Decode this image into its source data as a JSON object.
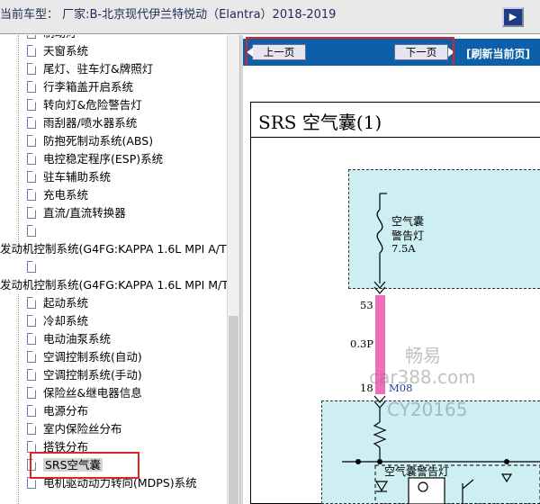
{
  "header": {
    "title": "当前车型： 厂家:B-北京现代伊兰特悦动（Elantra）2018-2019",
    "toggle_icon": "panel-toggle-icon"
  },
  "tree": {
    "items": [
      {
        "label": "制动灯",
        "type": "leaf"
      },
      {
        "label": "天窗系统",
        "type": "leaf"
      },
      {
        "label": "尾灯、驻车灯&牌照灯",
        "type": "leaf"
      },
      {
        "label": "行李箱盖开启系统",
        "type": "leaf"
      },
      {
        "label": "转向灯&危险警告灯",
        "type": "leaf"
      },
      {
        "label": "雨刮器/喷水器系统",
        "type": "leaf"
      },
      {
        "label": "防抱死制动系统(ABS)",
        "type": "leaf"
      },
      {
        "label": "电控稳定程序(ESP)系统",
        "type": "leaf"
      },
      {
        "label": "驻车辅助系统",
        "type": "leaf"
      },
      {
        "label": "充电系统",
        "type": "leaf"
      },
      {
        "label": "直流/直流转换器",
        "type": "leaf"
      },
      {
        "label": "",
        "type": "leaf"
      },
      {
        "label": "发动机控制系统(G4FG:KAPPA 1.6L MPI A/T",
        "type": "folder"
      },
      {
        "label": "",
        "type": "leaf"
      },
      {
        "label": "发动机控制系统(G4FG:KAPPA 1.6L MPI M/T",
        "type": "folder"
      },
      {
        "label": "起动系统",
        "type": "leaf"
      },
      {
        "label": "冷却系统",
        "type": "leaf"
      },
      {
        "label": "电动油泵系统",
        "type": "leaf"
      },
      {
        "label": "空调控制系统(自动)",
        "type": "leaf"
      },
      {
        "label": "空调控制系统(手动)",
        "type": "leaf"
      },
      {
        "label": "保险丝&继电器信息",
        "type": "leaf"
      },
      {
        "label": "电源分布",
        "type": "leaf"
      },
      {
        "label": "室内保险丝分布",
        "type": "leaf"
      },
      {
        "label": "搭铁分布",
        "type": "leaf"
      },
      {
        "label": "SRS空气囊",
        "type": "leaf",
        "selected": true
      },
      {
        "label": "电机驱动动力转向(MDPS)系统",
        "type": "leaf"
      }
    ]
  },
  "nav": {
    "prev_label": "上一页",
    "next_label": "下一页",
    "refresh_label": "[刷新当前页]"
  },
  "diagram": {
    "title": "SRS   空气囊(1)",
    "fuse_name": "空气囊",
    "fuse_name2": "警告灯",
    "fuse_rating": "7.5A",
    "pin_top": "53",
    "wire_spec": "0.3P",
    "pin_bottom": "18",
    "connector": "M08",
    "indicator_label": "空气囊警告灯"
  },
  "watermark": {
    "line1": "畅易",
    "line2": "car388.com",
    "line3": "CY20165"
  },
  "colors": {
    "nav_blue": "#0c5fa8",
    "box_fill": "#cdeef2",
    "wire_pink": "#ee6fb8",
    "annotation_red": "#e02424"
  }
}
